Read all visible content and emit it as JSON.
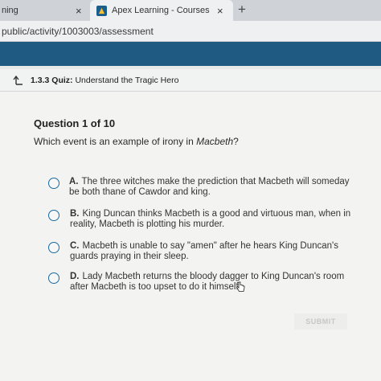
{
  "browser": {
    "tabs": [
      {
        "label": "ning",
        "close": "×"
      },
      {
        "label": "Apex Learning - Courses",
        "close": "×"
      }
    ],
    "new_tab": "+",
    "url": "public/activity/1003003/assessment"
  },
  "quiz": {
    "header_number": "1.3.3",
    "header_type": "Quiz:",
    "header_title": "Understand the Tragic Hero",
    "question_counter": "Question 1 of 10",
    "question_prefix": "Which event is an example of irony in ",
    "question_work": "Macbeth",
    "question_suffix": "?",
    "options": [
      {
        "letter": "A.",
        "text": "The three witches make the prediction that Macbeth will someday be both thane of Cawdor and king."
      },
      {
        "letter": "B.",
        "text": "King Duncan thinks Macbeth is a good and virtuous man, when in reality, Macbeth is plotting his murder."
      },
      {
        "letter": "C.",
        "text": "Macbeth is unable to say \"amen\" after he hears King Duncan's guards praying in their sleep."
      },
      {
        "letter": "D.",
        "text": "Lady Macbeth returns the bloody dagger to King Duncan's room after Macbeth is too upset to do it himself."
      }
    ],
    "submit_label": "SUBMIT"
  },
  "icons": {
    "back": "return-arrow-icon",
    "favicon": "apex-favicon",
    "cursor": "hand-pointer-icon"
  },
  "colors": {
    "nav_strip": "#1e5a82",
    "radio_border": "#1c6aa0"
  }
}
